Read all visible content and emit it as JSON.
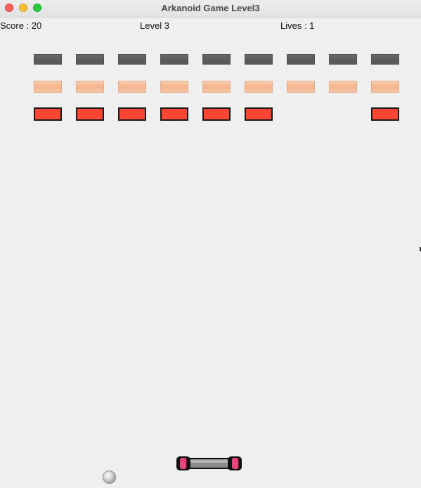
{
  "window": {
    "title": "Arkanoid Game Level3"
  },
  "hud": {
    "score_text": "Score : 20",
    "level_text": "Level 3",
    "lives_text": "Lives : 1"
  },
  "game": {
    "brick_rows": [
      {
        "type": "gray",
        "present": [
          true,
          true,
          true,
          true,
          true,
          true,
          true,
          true,
          true
        ]
      },
      {
        "type": "peach",
        "present": [
          true,
          true,
          true,
          true,
          true,
          true,
          true,
          true,
          true
        ]
      },
      {
        "type": "red",
        "present": [
          true,
          true,
          true,
          true,
          true,
          true,
          false,
          false,
          true
        ]
      }
    ],
    "colors": {
      "gray_brick": "#5e5e5e",
      "peach_brick": "#f3b48e",
      "red_brick": "#fd4533",
      "paddle_body": "#8c8c8c",
      "paddle_caps": "#e8457a"
    }
  }
}
